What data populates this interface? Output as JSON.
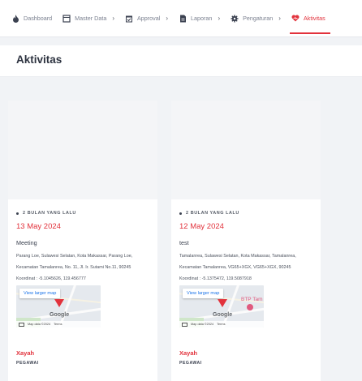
{
  "nav": {
    "items": [
      {
        "label": "Dashboard",
        "icon": "fire-icon",
        "has_chevron": false
      },
      {
        "label": "Master Data",
        "icon": "window-icon",
        "has_chevron": true
      },
      {
        "label": "Approval",
        "icon": "calendar-check-icon",
        "has_chevron": true
      },
      {
        "label": "Laporan",
        "icon": "document-icon",
        "has_chevron": true
      },
      {
        "label": "Pengaturan",
        "icon": "gear-icon",
        "has_chevron": true
      },
      {
        "label": "Aktivitas",
        "icon": "heart-icon",
        "has_chevron": false,
        "active": true
      }
    ],
    "chevron": "›"
  },
  "page": {
    "title": "Aktivitas"
  },
  "colors": {
    "accent": "#e2323c",
    "background": "#f1f3f6",
    "card": "#ffffff"
  },
  "cards": [
    {
      "meta": "2 BULAN YANG LALU",
      "date": "13 May 2024",
      "title": "Meeting",
      "address": "Parang Loe, Sulawesi Selatan, Kota Makassar, Parang Loe, Kecamatan Tamalanrea, No. 11, Jl. Ir. Sutami No.11, 90245",
      "coordinates": "Koordinat : -5.1045626, 119.456777",
      "map": {
        "button": "View larger map",
        "brand": "Google",
        "attribution": "Map data ©2024",
        "terms": "Terms"
      },
      "user": "Xayah",
      "role": "PEGAWAI"
    },
    {
      "meta": "2 BULAN YANG LALU",
      "date": "12 May 2024",
      "title": "test",
      "address": "Tamalanrea, Sulawesi Selatan, Kota Makassar, Tamalanrea, Kecamatan Tamalanrea, VG65+XGX, VG65+XGX, 90245",
      "coordinates": "Koordinat : -5.1375472, 119.5087918",
      "map": {
        "button": "View larger map",
        "brand": "Google",
        "attribution": "Map data ©2024",
        "terms": "Terms",
        "poi_label": "BTP Tam"
      },
      "user": "Xayah",
      "role": "PEGAWAI"
    }
  ]
}
